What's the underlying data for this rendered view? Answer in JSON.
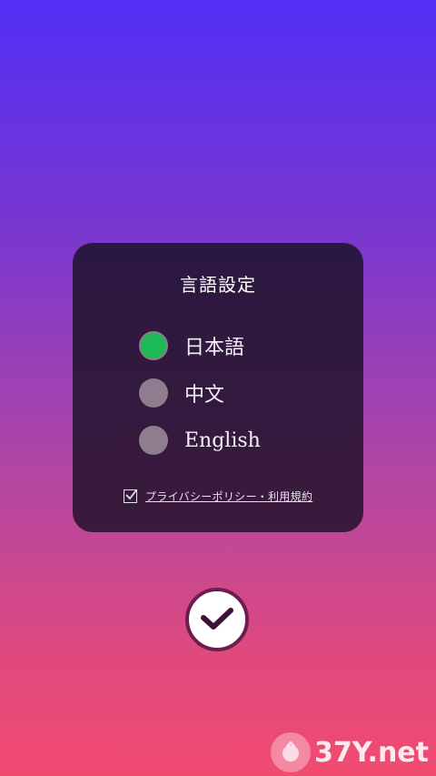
{
  "dialog": {
    "title": "言語設定",
    "languages": [
      {
        "label": "日本語",
        "selected": true
      },
      {
        "label": "中文",
        "selected": false
      },
      {
        "label": "English",
        "selected": false
      }
    ],
    "terms": {
      "label": "プライバシーポリシー・利用規約",
      "checked": true
    }
  },
  "colors": {
    "selected_radio": "#1db954",
    "unselected_radio": "#8e7d8e",
    "dialog_bg": "#2a1840",
    "confirm_border": "#6b1f50"
  },
  "confirm": {
    "icon": "checkmark-icon"
  },
  "watermark": {
    "text": "37Y.net"
  }
}
